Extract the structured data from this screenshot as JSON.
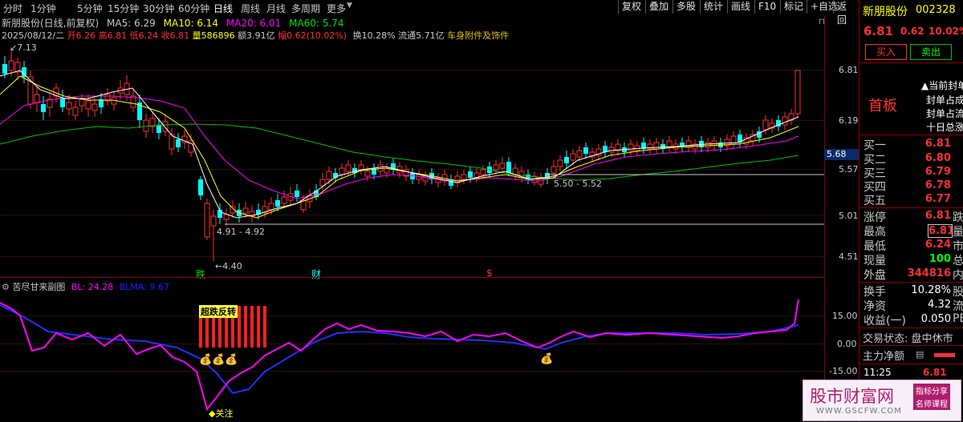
{
  "toolbar": {
    "tabs": [
      "分时",
      "1分钟",
      "5分钟",
      "15分钟",
      "30分钟",
      "60分钟",
      "日线",
      "周线",
      "月线",
      "多周期",
      "更多"
    ],
    "active_tab": "日线",
    "buttons": [
      "复权",
      "叠加",
      "多股",
      "统计",
      "画线",
      "F10",
      "标记",
      "+自选",
      "返回"
    ]
  },
  "chart_header": {
    "stock_name": "新朋股份(日线,前复权)",
    "ma5": "MA5: 6.29",
    "ma10": "MA10: 6.14",
    "ma20": "MA20: 6.01",
    "ma60": "MA60: 5.74",
    "date": "2025/08/12/二",
    "open": "开6.26",
    "high": "高6.81",
    "low": "低6.24",
    "close": "收6.81",
    "volume": "量586896",
    "amount": "额3.91亿",
    "change": "幅0.62(10.02%)",
    "turnover": "换10.28%",
    "float_cap": "流通5.71亿",
    "sector": "车身附件及饰件"
  },
  "price_axis": [
    "6.81",
    "6.19",
    "5.57",
    "5.01",
    "4.51"
  ],
  "price_marker": "5.68",
  "annotations": {
    "high_label": "7.13",
    "low_label": "4.40",
    "range1": "4.91 - 4.92",
    "range2": "5.50 - 5.52",
    "event_fall": "跌",
    "event_finance": "财",
    "event_s": "$"
  },
  "indicator": {
    "title": "苦尽甘来副图",
    "bl": "BL: 24.28",
    "blma": "BLMA: 9.67",
    "axis": [
      "15.00",
      "0.00",
      "-15.00"
    ],
    "signal_text": "超跌反转",
    "watch_text": "关注"
  },
  "quote_panel": {
    "name": "新朋股份",
    "code": "002328",
    "price": "6.81",
    "change": "0.62",
    "pct": "10.02%",
    "buy_btn": "买入",
    "sell_btn": "卖出",
    "board": "首板",
    "notes": [
      "当前封单",
      "封单占成",
      "封单占流",
      "十日总涨"
    ],
    "bids": [
      {
        "label": "买一",
        "value": "6.81"
      },
      {
        "label": "买二",
        "value": "6.80"
      },
      {
        "label": "买三",
        "value": "6.79"
      },
      {
        "label": "买四",
        "value": "6.78"
      },
      {
        "label": "买五",
        "value": "6.77"
      }
    ],
    "stats": [
      {
        "label": "涨停",
        "value": "6.81",
        "cut": "跌"
      },
      {
        "label": "最高",
        "value": "6.81",
        "cut": "量"
      },
      {
        "label": "最低",
        "value": "6.24",
        "cut": "市"
      },
      {
        "label": "现量",
        "value": "100",
        "cut": "总"
      },
      {
        "label": "外盘",
        "value": "344816",
        "cut": "内"
      }
    ],
    "stats2": [
      {
        "label": "换手",
        "value": "10.28%",
        "cut": "股"
      },
      {
        "label": "净资",
        "value": "4.32",
        "cut": "流"
      },
      {
        "label": "收益(一)",
        "value": "0.050",
        "cut": "PE"
      }
    ],
    "trade_status": "交易状态: 盘中休市",
    "main_flow": "主力净额",
    "time": "11:25",
    "last": "6.81"
  },
  "watermark": {
    "site": "股市财富网",
    "tag1": "指标分享",
    "tag2": "名师课程",
    "url": "WWW.GSCFW.COM"
  },
  "colors": {
    "up": "#ff3030",
    "down": "#00ffff",
    "ma5": "#ffffff",
    "ma10": "#ffff00",
    "ma20": "#ff00ff",
    "ma60": "#00c000"
  }
}
